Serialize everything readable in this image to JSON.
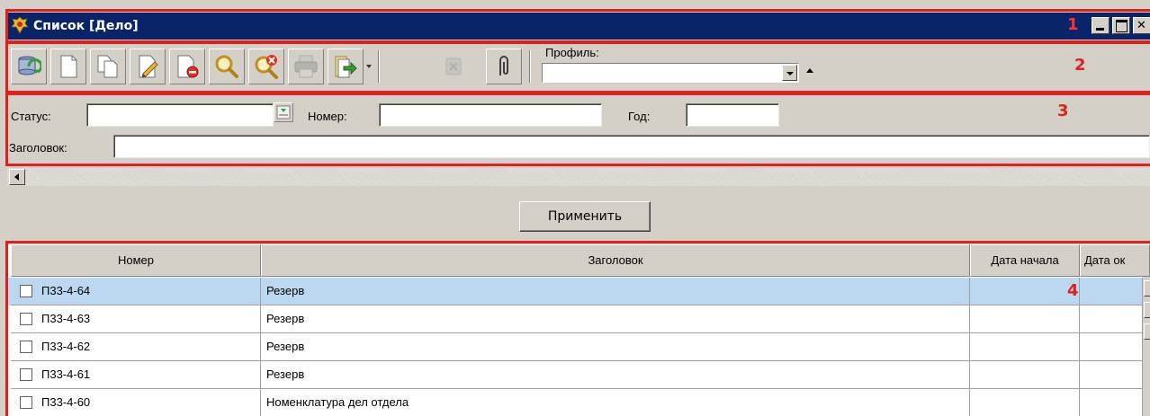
{
  "window": {
    "title": "Список [Дело]"
  },
  "toolbar": {
    "buttons": [
      {
        "icon": "refresh-icon"
      },
      {
        "icon": "new-document-icon"
      },
      {
        "icon": "copy-document-icon"
      },
      {
        "icon": "edit-document-icon"
      },
      {
        "icon": "delete-document-icon"
      },
      {
        "icon": "search-icon"
      },
      {
        "icon": "clear-search-icon"
      },
      {
        "icon": "print-icon"
      },
      {
        "icon": "export-icon"
      },
      {
        "icon": "disabled-action-icon"
      },
      {
        "icon": "attachment-icon"
      }
    ],
    "profile_label": "Профиль:",
    "profile_value": ""
  },
  "filter": {
    "status_label": "Статус:",
    "status_value": "",
    "number_label": "Номер:",
    "number_value": "",
    "year_label": "Год:",
    "year_value": "",
    "title_label": "Заголовок:",
    "title_value": ""
  },
  "apply_label": "Применить",
  "grid": {
    "columns": [
      "Номер",
      "Заголовок",
      "Дата начала",
      "Дата ок"
    ],
    "rows": [
      {
        "number": "П33-4-64",
        "title": "Резерв",
        "start": "",
        "end": "",
        "selected": true
      },
      {
        "number": "П33-4-63",
        "title": "Резерв",
        "start": "",
        "end": "",
        "selected": false
      },
      {
        "number": "П33-4-62",
        "title": "Резерв",
        "start": "",
        "end": "",
        "selected": false
      },
      {
        "number": "П33-4-61",
        "title": "Резерв",
        "start": "",
        "end": "",
        "selected": false
      },
      {
        "number": "П33-4-60",
        "title": "Номенклатура дел отдела",
        "start": "",
        "end": "",
        "selected": false
      }
    ]
  },
  "annotations": [
    "1",
    "2",
    "3",
    "4"
  ],
  "colors": {
    "titlebar": "#0a246a",
    "annotation": "#e0201c",
    "selected_row": "#bcd8f0",
    "face": "#d4d0c8"
  }
}
